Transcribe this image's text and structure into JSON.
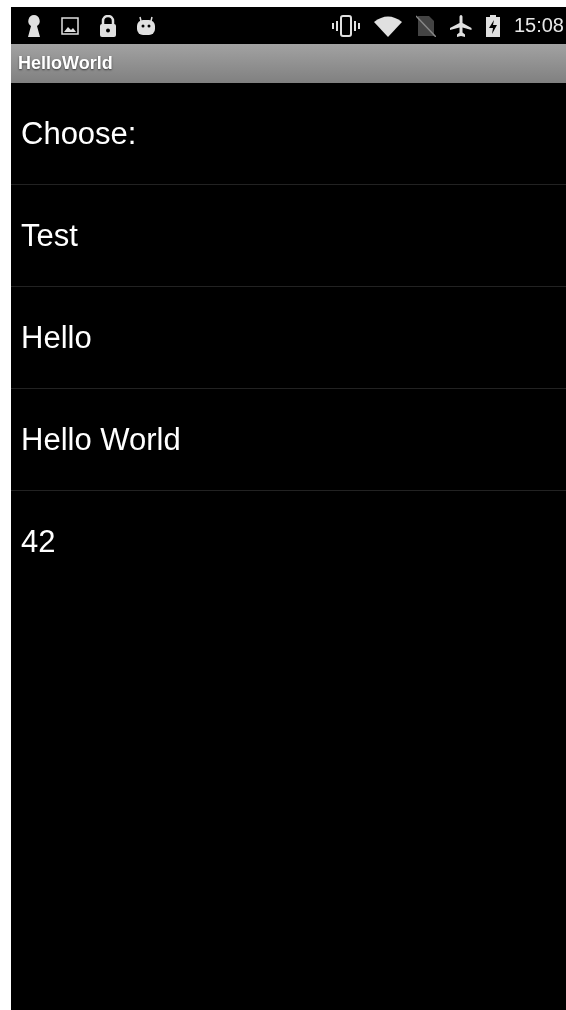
{
  "status_bar": {
    "time": "15:08"
  },
  "title_bar": {
    "title": "HelloWorld"
  },
  "list": {
    "items": [
      {
        "label": "Choose:"
      },
      {
        "label": "Test"
      },
      {
        "label": "Hello"
      },
      {
        "label": "Hello World"
      },
      {
        "label": "42"
      }
    ]
  }
}
